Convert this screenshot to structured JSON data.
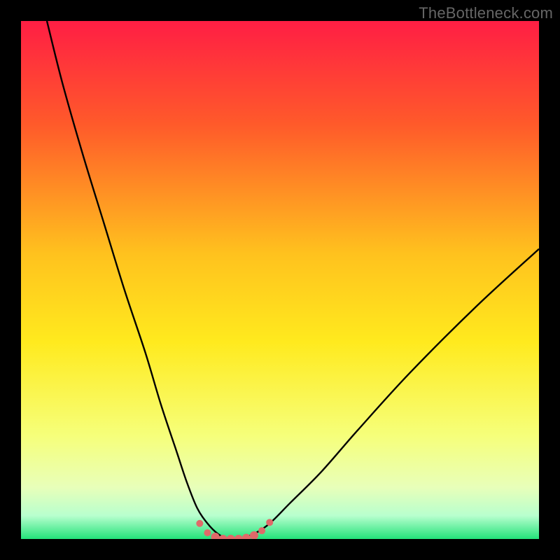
{
  "watermark": "TheBottleneck.com",
  "colors": {
    "frame": "#000000",
    "curve": "#000000",
    "marker": "#e06969",
    "gradient_stops": [
      {
        "offset": 0,
        "color": "#ff1e44"
      },
      {
        "offset": 0.2,
        "color": "#ff5a2a"
      },
      {
        "offset": 0.45,
        "color": "#ffc21e"
      },
      {
        "offset": 0.62,
        "color": "#ffea1e"
      },
      {
        "offset": 0.8,
        "color": "#f6ff7a"
      },
      {
        "offset": 0.9,
        "color": "#e8ffb9"
      },
      {
        "offset": 0.955,
        "color": "#b8ffce"
      },
      {
        "offset": 1.0,
        "color": "#23e27a"
      }
    ]
  },
  "chart_data": {
    "type": "line",
    "title": "",
    "xlabel": "",
    "ylabel": "",
    "xlim": [
      0,
      100
    ],
    "ylim": [
      0,
      100
    ],
    "grid": false,
    "legend": false,
    "series": [
      {
        "name": "bottleneck-curve",
        "x": [
          5,
          8,
          12,
          16,
          20,
          24,
          27,
          30,
          32,
          34,
          36,
          38,
          40,
          42,
          45,
          48,
          52,
          58,
          65,
          75,
          88,
          100
        ],
        "y": [
          100,
          88,
          74,
          61,
          48,
          36,
          26,
          17,
          11,
          6,
          3,
          1,
          0,
          0,
          1,
          3,
          7,
          13,
          21,
          32,
          45,
          56
        ]
      }
    ],
    "markers": {
      "name": "flat-bottom-dots",
      "x": [
        34.5,
        36,
        37.5,
        39,
        40.5,
        42,
        43.5,
        45,
        46.5,
        48
      ],
      "y": [
        3.0,
        1.2,
        0.4,
        0.0,
        0.0,
        0.0,
        0.2,
        0.7,
        1.6,
        3.2
      ],
      "r": [
        5,
        5,
        6,
        6,
        6,
        6,
        6,
        6,
        5,
        5
      ]
    }
  }
}
